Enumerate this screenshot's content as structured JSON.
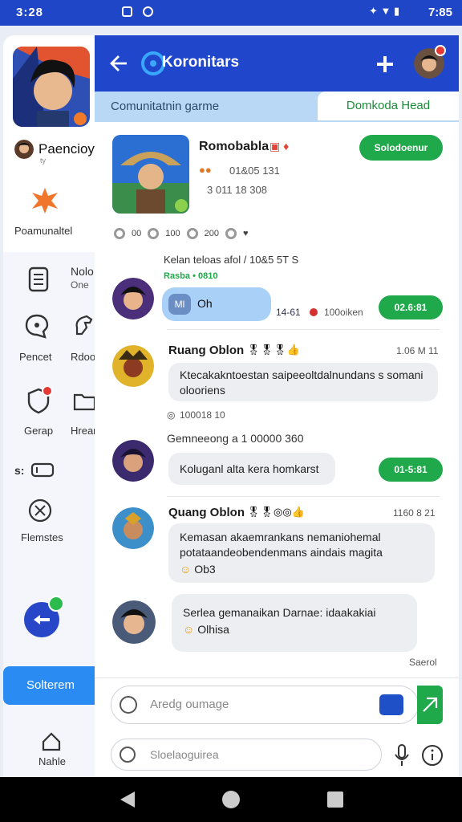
{
  "status_bar": {
    "time_left": "3:28",
    "time_right": "7:85"
  },
  "sidebar": {
    "profile_name": "Paencioy",
    "profile_sub": "ty",
    "feature_label": "Poamunaltel",
    "items": [
      {
        "label": "Nolo",
        "sub": "One",
        "icon": "document-icon"
      },
      {
        "label": "Pencet",
        "icon": "chat-bubble-icon"
      },
      {
        "label": "Rdoo",
        "icon": "horse-icon"
      },
      {
        "label": "Gerap",
        "icon": "shield-icon"
      },
      {
        "label": "Hrear",
        "icon": "folder-icon"
      },
      {
        "label": "Flemstes",
        "icon": "atom-icon"
      }
    ],
    "cluster_label": "s:",
    "primary_button": "Solterem",
    "bottom_label": "Nahle"
  },
  "header": {
    "title": "Koronitars"
  },
  "tabs": {
    "left": "Comunitatnin garme",
    "right": "Domkoda Head"
  },
  "featured": {
    "title": "Romobabla",
    "meta1": "01&05 131",
    "meta2": "3 011 18 308",
    "button": "Solodoenur",
    "stats": [
      "00",
      "100",
      "200"
    ]
  },
  "messages": [
    {
      "sender": "Kelan teloas afol / 10&5 5T  S",
      "sub": "Rasba • 0810",
      "text": "Oh",
      "chip": "Ml",
      "time": "14-61",
      "status": "100oiken",
      "button": "02.6:81"
    },
    {
      "sender": "Ruang Oblon",
      "time": "1.06 M 11",
      "text": "Ktecakakntoestan saipeeoltdalnundans s somani olooriens",
      "foot": "100018 10"
    },
    {
      "sender": "Gemneeong a 1 00000 360",
      "text": "Koluganl alta kera homkarst",
      "button": "01-5:81"
    },
    {
      "sender": "Quang Oblon",
      "time": "1160 8 21",
      "text": "Kemasan akaemrankans nemaniohemal potataandeobendenmans aindais magita",
      "foot": "Ob3"
    },
    {
      "sender": "",
      "text": "Serlea gemanaikan Darnae: idaakakiai",
      "foot": "Olhisa",
      "time": "Saerol"
    }
  ],
  "composer": {
    "placeholder": "Aredg oumage",
    "placeholder2": "Sloelaoguirea"
  }
}
